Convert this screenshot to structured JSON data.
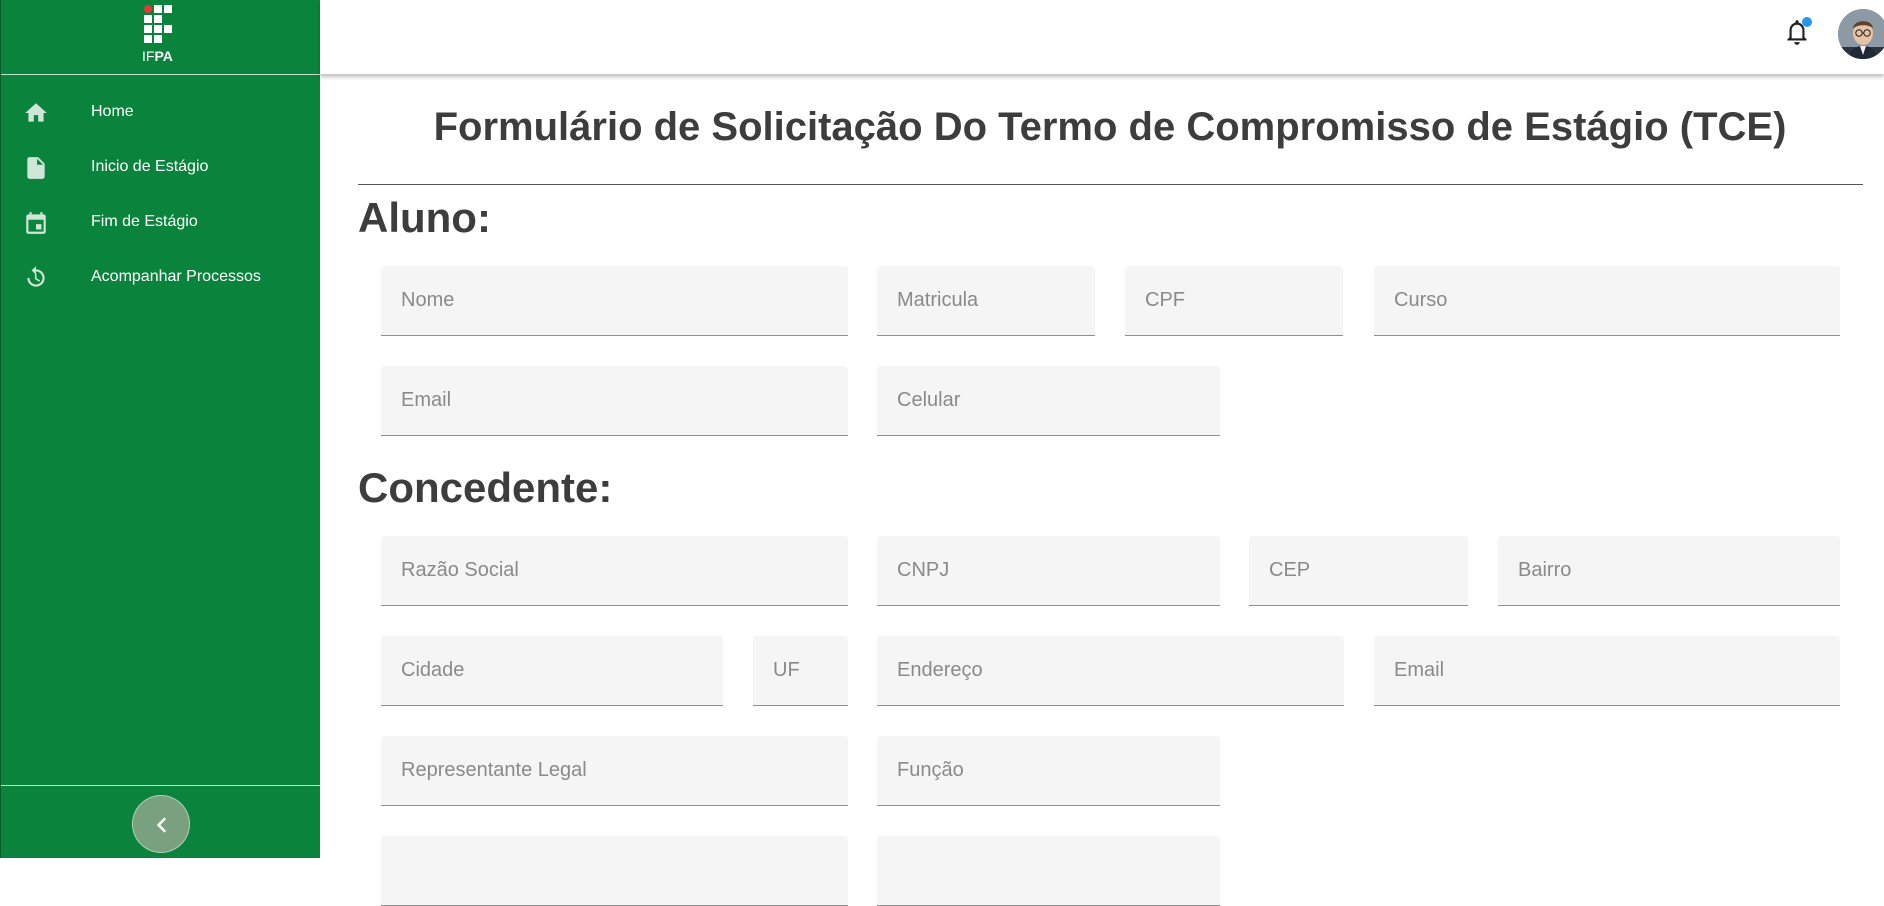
{
  "logo": {
    "prefix": "IF",
    "suffix": "PA"
  },
  "sidebar": {
    "items": [
      {
        "label": "Home",
        "icon": "home-icon"
      },
      {
        "label": "Inicio de Estágio",
        "icon": "document-icon"
      },
      {
        "label": "Fim de Estágio",
        "icon": "calendar-icon"
      },
      {
        "label": "Acompanhar Processos",
        "icon": "refresh-icon"
      }
    ],
    "collapse_icon": "chevron-left-icon"
  },
  "topbar": {
    "notification_icon": "bell-icon",
    "has_unread": true
  },
  "form": {
    "title": "Formulário de Solicitação Do Termo de Compromisso de Estágio (TCE)",
    "aluno": {
      "heading": "Aluno:",
      "nome": "Nome",
      "matricula": "Matricula",
      "cpf": "CPF",
      "curso": "Curso",
      "email": "Email",
      "celular": "Celular"
    },
    "concedente": {
      "heading": "Concedente:",
      "razao_social": "Razão Social",
      "cnpj": "CNPJ",
      "cep": "CEP",
      "bairro": "Bairro",
      "cidade": "Cidade",
      "uf": "UF",
      "endereco": "Endereço",
      "email": "Email",
      "representante": "Representante Legal",
      "funcao": "Função"
    }
  },
  "colors": {
    "sidebar_green": "#0a843d",
    "field_bg": "#f5f5f5",
    "title_text": "#3d3d3d",
    "notification_dot": "#2196f3"
  }
}
